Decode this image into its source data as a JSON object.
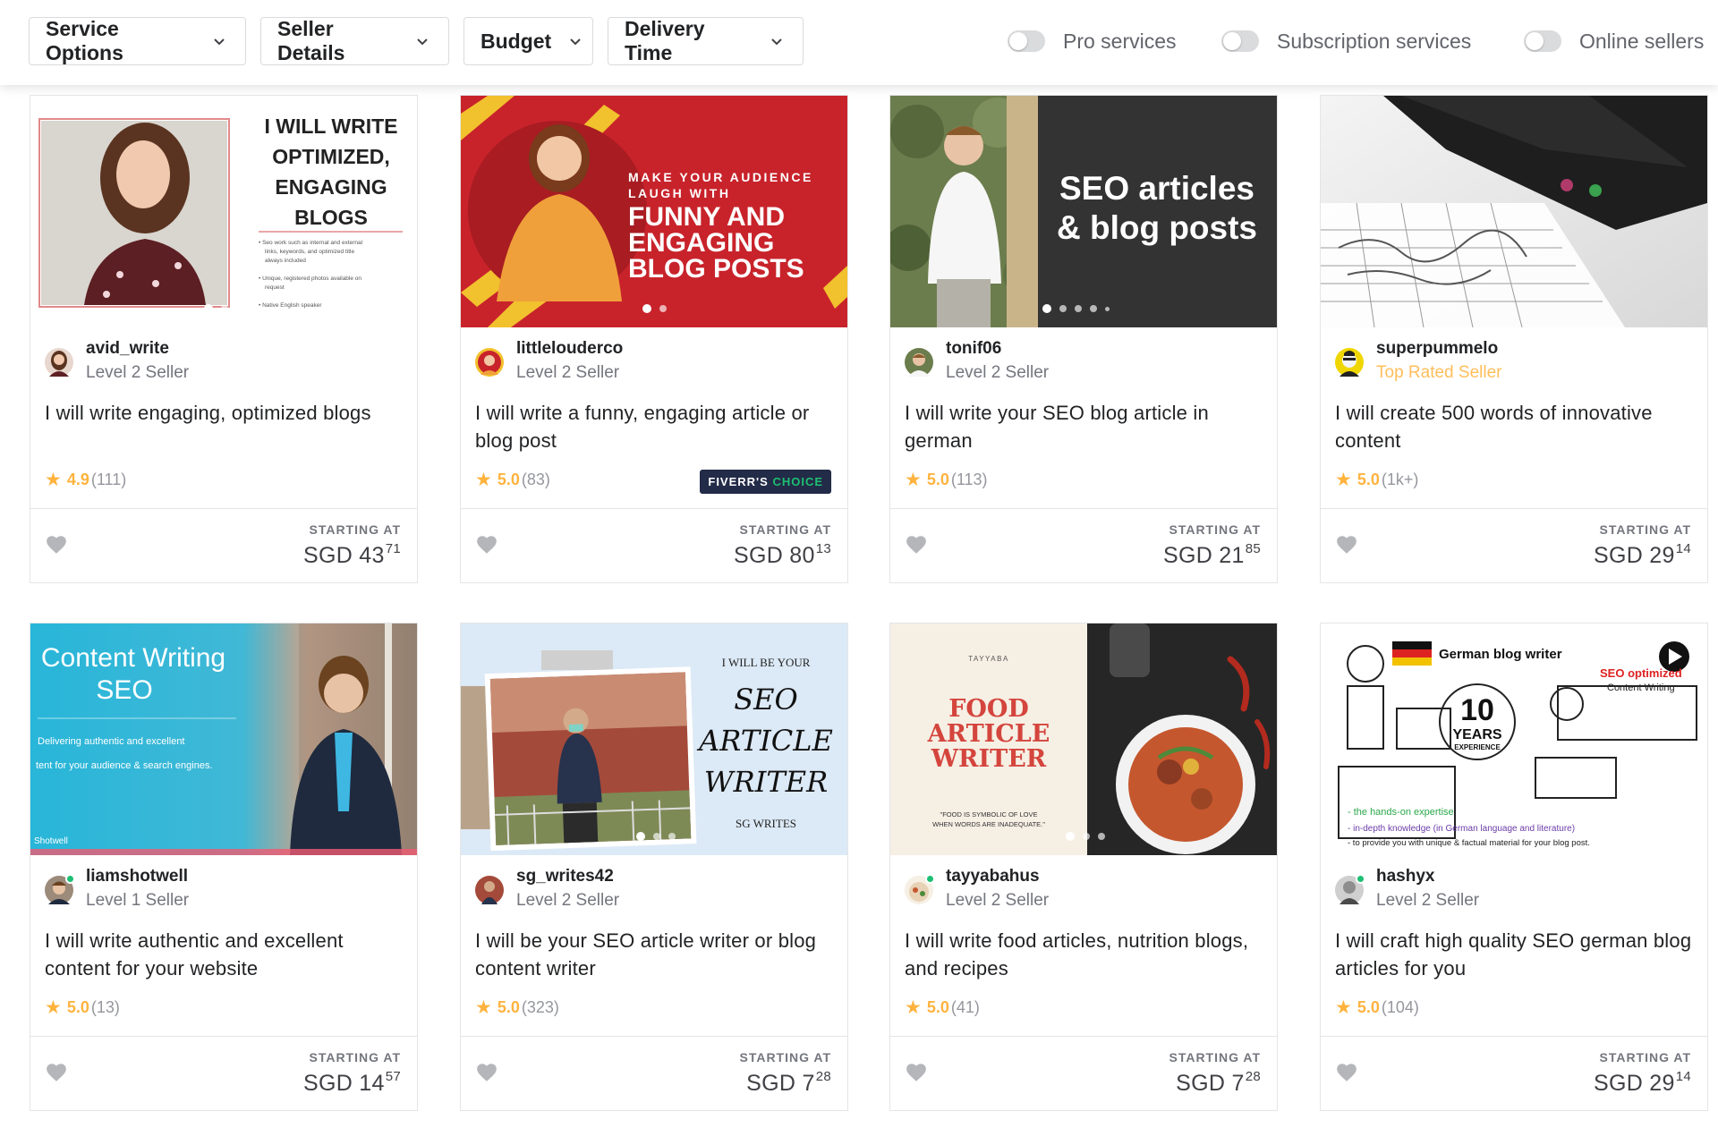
{
  "filters": {
    "buttons": [
      {
        "label": "Service Options"
      },
      {
        "label": "Seller Details"
      },
      {
        "label": "Budget"
      },
      {
        "label": "Delivery Time"
      }
    ],
    "toggles": [
      {
        "label": "Pro services",
        "on": false
      },
      {
        "label": "Subscription services",
        "on": false
      },
      {
        "label": "Online sellers",
        "on": false
      }
    ]
  },
  "gigs": [
    {
      "seller": "avid_write",
      "level": "Level 2 Seller",
      "title": "I will write engaging, optimized blogs",
      "rating": "4.9",
      "reviews": "(111)",
      "starting": "STARTING AT",
      "price_main": "SGD 43",
      "price_cents": "71",
      "thumb": {
        "headline": [
          "I WILL WRITE",
          "OPTIMIZED,",
          "ENGAGING",
          "BLOGS"
        ],
        "bullets": [
          "• Seo work such as internal and external",
          "links, keywords, and optimized title",
          "always included",
          "• Unique, registered photos available on",
          "request",
          "• Native English speaker"
        ]
      }
    },
    {
      "seller": "littlelouderco",
      "level": "Level 2 Seller",
      "title": "I will write a funny, engaging article or blog post",
      "rating": "5.0",
      "reviews": "(83)",
      "badge": "FIVERR'S",
      "badge_accent": "CHOICE",
      "starting": "STARTING AT",
      "price_main": "SGD 80",
      "price_cents": "13",
      "thumb": {
        "small": [
          "MAKE YOUR AUDIENCE",
          "LAUGH WITH"
        ],
        "big": [
          "FUNNY AND",
          "ENGAGING",
          "BLOG POSTS"
        ]
      }
    },
    {
      "seller": "tonif06",
      "level": "Level 2 Seller",
      "title": "I will write your SEO blog article in german",
      "rating": "5.0",
      "reviews": "(113)",
      "starting": "STARTING AT",
      "price_main": "SGD 21",
      "price_cents": "85",
      "thumb": {
        "lines": [
          "SEO articles",
          "& blog posts"
        ]
      }
    },
    {
      "seller": "superpummelo",
      "level": "Top Rated Seller",
      "title": "I will create 500 words of innovative content",
      "rating": "5.0",
      "reviews": "(1k+)",
      "starting": "STARTING AT",
      "price_main": "SGD 29",
      "price_cents": "14"
    },
    {
      "seller": "liamshotwell",
      "level": "Level 1 Seller",
      "title": "I will write authentic and excellent content for your website",
      "rating": "5.0",
      "reviews": "(13)",
      "starting": "STARTING AT",
      "price_main": "SGD 14",
      "price_cents": "57",
      "thumb": {
        "lines": [
          "Content Writing",
          "SEO"
        ],
        "sub": [
          "Delivering authentic and excellent",
          "tent for your audience & search engines."
        ],
        "mark": "Shotwell"
      }
    },
    {
      "seller": "sg_writes42",
      "level": "Level 2 Seller",
      "title": "I will be your SEO article writer or blog content writer",
      "rating": "5.0",
      "reviews": "(323)",
      "starting": "STARTING AT",
      "price_main": "SGD 7",
      "price_cents": "28",
      "thumb": {
        "small": "I WILL BE YOUR",
        "lines": [
          "SEO",
          "ARTICLE",
          "WRITER"
        ],
        "sign": "SG WRITES"
      }
    },
    {
      "seller": "tayyabahus",
      "level": "Level 2 Seller",
      "title": "I will write food articles, nutrition blogs, and recipes",
      "rating": "5.0",
      "reviews": "(41)",
      "starting": "STARTING AT",
      "price_main": "SGD 7",
      "price_cents": "28",
      "thumb": {
        "brand": "TAYYABA",
        "lines": [
          "FOOD",
          "ARTICLE",
          "WRITER"
        ],
        "quote": [
          "\"FOOD IS SYMBOLIC OF LOVE",
          "WHEN WORDS ARE INADEQUATE.\""
        ]
      }
    },
    {
      "seller": "hashyx",
      "level": "Level 2 Seller",
      "title": "I will craft high quality SEO german blog articles for you",
      "rating": "5.0",
      "reviews": "(104)",
      "starting": "STARTING AT",
      "price_main": "SGD 29",
      "price_cents": "14",
      "thumb": {
        "header": "German blog writer",
        "seo": [
          "SEO optimized",
          "Content Writing"
        ],
        "years": [
          "10",
          "YEARS",
          "EXPERIENCE"
        ],
        "bullets": [
          "- the hands-on expertise",
          "- in-depth knowledge (in German language and literature)",
          "- to provide you with unique & factual material for your blog post."
        ]
      }
    }
  ]
}
